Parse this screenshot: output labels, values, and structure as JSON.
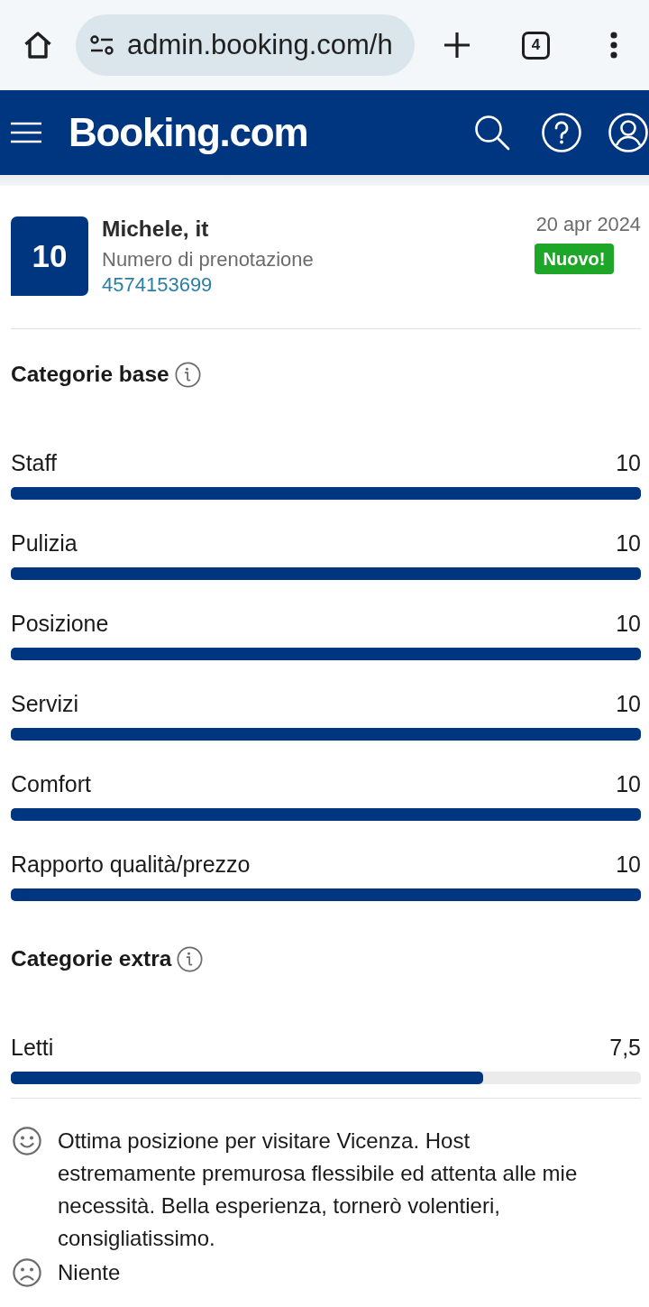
{
  "browser": {
    "url": "admin.booking.com/h",
    "tab_count": "4"
  },
  "header": {
    "logo": "Booking.com"
  },
  "review": {
    "score": "10",
    "guest": "Michele, it",
    "booking_label": "Numero di prenotazione",
    "booking_number": "4574153699",
    "date": "20 apr 2024",
    "badge": "Nuovo!"
  },
  "sections": [
    {
      "title": "Categorie base",
      "categories": [
        {
          "name": "Staff",
          "score": "10",
          "level": 1
        },
        {
          "name": "Pulizia",
          "score": "10",
          "level": 1
        },
        {
          "name": "Posizione",
          "score": "10",
          "level": 1
        },
        {
          "name": "Servizi",
          "score": "10",
          "level": 1
        },
        {
          "name": "Comfort",
          "score": "10",
          "level": 1
        },
        {
          "name": "Rapporto qualità/prezzo",
          "score": "10",
          "level": 1
        }
      ]
    },
    {
      "title": "Categorie extra",
      "categories": [
        {
          "name": "Letti",
          "score": "7,5",
          "level": 0.75
        }
      ]
    }
  ],
  "comments": [
    {
      "kind": "positive",
      "text": "Ottima posizione per visitare Vicenza. Host estremamente premurosa flessibile ed attenta alle mie necessità. Bella esperienza, tornerò volentieri, consigliatissimo."
    },
    {
      "kind": "negative",
      "text": "Niente"
    }
  ]
}
